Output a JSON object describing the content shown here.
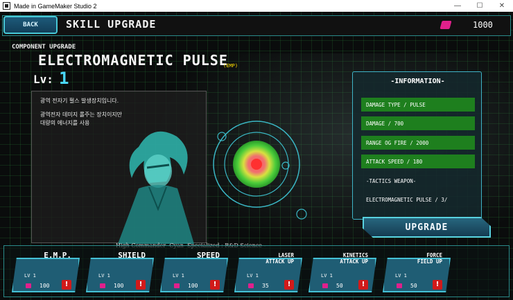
{
  "window": {
    "title": "Made in GameMaker Studio 2",
    "controls": [
      "—",
      "☐",
      "✕"
    ]
  },
  "header": {
    "back_label": "BACK",
    "title": "SKILL UPGRADE",
    "currency_icon": "gem-icon",
    "currency_value": "1000"
  },
  "component": {
    "section_label": "COMPONENT UPGRADE",
    "name": "ELECTROMAGNETIC PULSE",
    "abbr": "(EMP)",
    "level_label": "Lv:",
    "level_value": "1",
    "description": [
      "광역 전자기 펄스 발생장치입니다.",
      "광역전자 데미지 롤주는 장치이지만",
      "대량의 에너지를 사용"
    ],
    "caption": "High Commander -Cyan- Specialized : R&D Science -"
  },
  "info": {
    "title": "-INFORMATION-",
    "rows": [
      {
        "text": "DAMAGE TYPE / PULSE",
        "highlight": true
      },
      {
        "text": " DAMAGE  / 700",
        "highlight": true
      },
      {
        "text": "RANGE OG FIRE / 2000",
        "highlight": true
      },
      {
        "text": "ATTACK SPEED / 180",
        "highlight": true
      },
      {
        "text": "-TACTICS WEAPON-",
        "highlight": false
      },
      {
        "text": "ELECTROMAGNETIC PULSE / 3/",
        "highlight": false
      }
    ]
  },
  "upgrade_label": "UPGRADE",
  "skills": [
    {
      "name": "E.M.P.",
      "name2": "",
      "lv": "LV   1",
      "cost": "100",
      "alert": "!"
    },
    {
      "name": "SHIELD",
      "name2": "",
      "lv": "LV   1",
      "cost": "100",
      "alert": "!"
    },
    {
      "name": "SPEED",
      "name2": "",
      "lv": "LV   1",
      "cost": "100",
      "alert": "!"
    },
    {
      "name": "LASER",
      "name2": "ATTACK UP",
      "lv": "LV   1",
      "cost": "35",
      "alert": "!"
    },
    {
      "name": "KINETICS",
      "name2": "ATTACK UP",
      "lv": "LV   1",
      "cost": "50",
      "alert": "!"
    },
    {
      "name": "FORCE",
      "name2": "FIELD UP",
      "lv": "LV   1",
      "cost": "50",
      "alert": "!"
    }
  ],
  "colors": {
    "accent": "#45c1d5",
    "info_row": "#1e7f1e",
    "gem": "#e0208c",
    "alert": "#d11a1a",
    "level": "#4ad8ff"
  }
}
